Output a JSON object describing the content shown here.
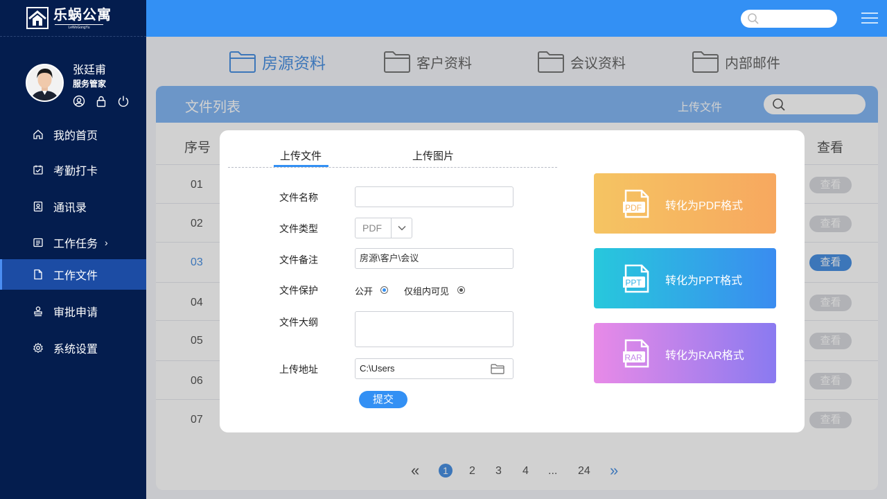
{
  "app": {
    "logo_text": "乐蜗公寓",
    "logo_sub": "LeWoGongYu"
  },
  "user": {
    "name": "张廷甫",
    "role": "服务管家"
  },
  "sidebar": {
    "items": [
      {
        "label": "我的首页"
      },
      {
        "label": "考勤打卡"
      },
      {
        "label": "通讯录"
      },
      {
        "label": "工作任务"
      },
      {
        "label": "工作文件"
      },
      {
        "label": "审批申请"
      },
      {
        "label": "系统设置"
      }
    ],
    "active_index": 4
  },
  "tabs": [
    "房源资料",
    "客户资料",
    "会议资料",
    "内部邮件"
  ],
  "panel": {
    "title": "文件列表",
    "upload_label": "上传文件"
  },
  "table": {
    "headers": {
      "index": "序号",
      "view": "查看"
    },
    "rows": [
      {
        "index": "01",
        "view": "查看"
      },
      {
        "index": "02",
        "view": "查看"
      },
      {
        "index": "03",
        "view": "查看"
      },
      {
        "index": "04",
        "view": "查看"
      },
      {
        "index": "05",
        "view": "查看"
      },
      {
        "index": "06",
        "view": "查看"
      },
      {
        "index": "07",
        "view": "查看"
      }
    ],
    "highlight_row": 2
  },
  "pagination": {
    "first": "«",
    "pages": [
      "1",
      "2",
      "3",
      "4",
      "...",
      "24"
    ],
    "current": "1",
    "next": "»"
  },
  "modal": {
    "tabs": [
      "上传文件",
      "上传图片"
    ],
    "fields": {
      "name_label": "文件名称",
      "name_value": "",
      "type_label": "文件类型",
      "type_value": "PDF",
      "note_label": "文件备注",
      "note_value": "房源\\客户\\会议",
      "protect_label": "文件保护",
      "protect_options": [
        "公开",
        "仅组内可见"
      ],
      "outline_label": "文件大纲",
      "outline_value": "",
      "path_label": "上传地址",
      "path_value": "C:\\Users"
    },
    "submit": "提交",
    "convert": {
      "pdf": {
        "label": "转化为PDF格式",
        "badge": "PDF"
      },
      "ppt": {
        "label": "转化为PPT格式",
        "badge": "PPT"
      },
      "rar": {
        "label": "转化为RAR格式",
        "badge": "RAR"
      }
    }
  },
  "colors": {
    "sidebar_bg": "#041d4e",
    "topbar": "#3390f4",
    "accent": "#4a90e2"
  }
}
